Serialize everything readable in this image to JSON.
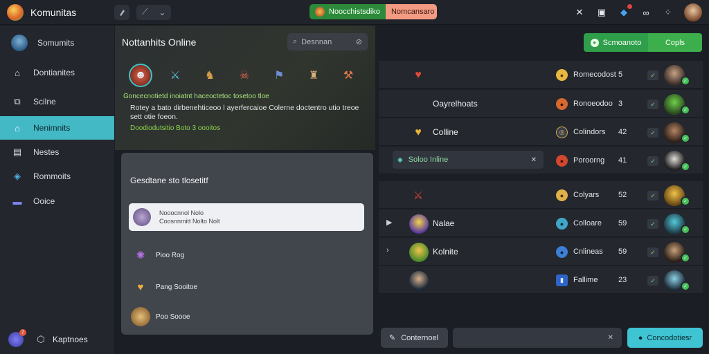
{
  "app": {
    "title": "Komunitas"
  },
  "topbar": {
    "pill_left": "Noocchistsdiko",
    "pill_right": "Nomcansaro",
    "icons": [
      "back-arrow-icon",
      "chevron-down-icon",
      "tools-icon",
      "chat-icon",
      "notification-icon",
      "link-icon",
      "grid-icon"
    ]
  },
  "sidebar": {
    "items": [
      {
        "label": "Somumits",
        "icon": "avatar"
      },
      {
        "label": "Dontianites",
        "icon": "home-icon"
      },
      {
        "label": "Scilne",
        "icon": "channel-icon"
      },
      {
        "label": "Nenimnits",
        "icon": "home-icon"
      },
      {
        "label": "Nestes",
        "icon": "grid-icon"
      },
      {
        "label": "Rommoits",
        "icon": "diamond-icon"
      },
      {
        "label": "Ooice",
        "icon": "card-icon"
      }
    ],
    "bottom_label": "Kaptnoes",
    "bottom_badge": "7"
  },
  "hero": {
    "title": "Nottanhits Online",
    "search_placeholder": "Desnnan",
    "meta": "Goncecnotietd inoiatnt haceoctetoc tosetoo tloe",
    "description": "Rotey a bato dirbenehticeoo l ayerfercaioe Colerne doctentro utio treoe sett otie foeon.",
    "tag": "Doodiodutsitio Boto 3 oooitos"
  },
  "card": {
    "title": "Gesdtane sto tlosetitf",
    "input_line1": "Nooocnnol      Nolo",
    "input_line2": "Coosnnmitt Nolto Nolt",
    "rows": [
      "Pioo  Rog",
      "Pang  Sooitoe",
      "Poo  Soooe"
    ]
  },
  "right": {
    "btn_primary": "Scmoanoto",
    "btn_secondary": "Copls",
    "rows": [
      {
        "name": "",
        "sub": "Romecodost",
        "count": "5"
      },
      {
        "name": "Oayrelhoats",
        "sub": "Ronoeodoo",
        "count": "3"
      },
      {
        "name": "Colline",
        "sub": "Colindors",
        "count": "42"
      },
      {
        "name": "Soloo Inline",
        "sub": "Poroorng",
        "count": "41"
      },
      {
        "name": "",
        "sub": "Colyars",
        "count": "52"
      },
      {
        "name": "Nalae",
        "sub": "Colloare",
        "count": "59"
      },
      {
        "name": "Kolnite",
        "sub": "Cnlineas",
        "count": "59"
      },
      {
        "name": "",
        "sub": "Fallime",
        "count": "23"
      }
    ]
  },
  "bottom": {
    "left_label": "Conternoel",
    "send_label": "Concodotiesr"
  },
  "colors": {
    "accent": "#43b9c6",
    "green": "#2f9e4a"
  }
}
